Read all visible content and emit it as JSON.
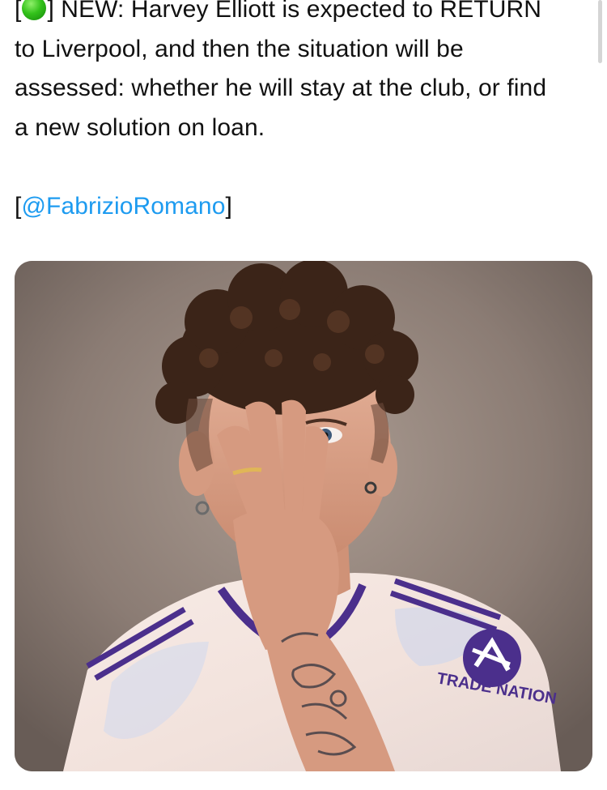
{
  "tweet": {
    "line1_open": "[",
    "line1_rest": "] NEW: Harvey Elliott is expected to RETURN",
    "line2": "to Liverpool, and then the situation will be",
    "line3": "assessed: whether he will stay at the club, or find",
    "line4": "a new solution on loan.",
    "source_open": "[",
    "source_handle": "@FabrizioRomano",
    "source_close": "]",
    "emoji": "green-circle-icon"
  },
  "photo": {
    "sleeve_text": "TRADE NATION",
    "colors": {
      "background": "#8a7b73",
      "shirt": "#f3e8e3",
      "trim": "#4b2f8c",
      "mention": "#1d9bf0"
    }
  }
}
